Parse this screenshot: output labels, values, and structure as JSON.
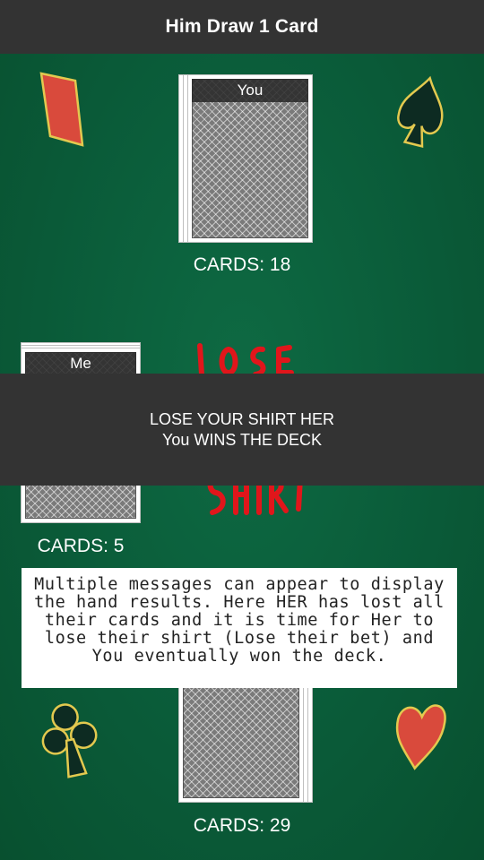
{
  "header": {
    "title": "Him Draw 1 Card"
  },
  "top_player": {
    "name": "You",
    "count_label": "CARDS: 18"
  },
  "left_player": {
    "name": "Me",
    "count_label": "CARDS: 5"
  },
  "bottom_player": {
    "count_label": "CARDS: 29"
  },
  "toast": {
    "line1": "LOSE YOUR SHIRT HER",
    "line2": "You WINS THE DECK"
  },
  "note": {
    "text": "Multiple messages can appear to display the hand results. Here HER has lost all their cards and it is time for Her to lose their shirt (Lose their bet) and You eventually won the deck."
  },
  "colors": {
    "felt": "#0b5e3b",
    "bar": "#333333",
    "suit_red": "#d94a3c",
    "suit_black": "#0d2b22",
    "suit_outline": "#e3c94f",
    "art_red": "#e0161b"
  },
  "icons": [
    "diamond-icon",
    "spade-icon",
    "club-icon",
    "heart-icon"
  ]
}
